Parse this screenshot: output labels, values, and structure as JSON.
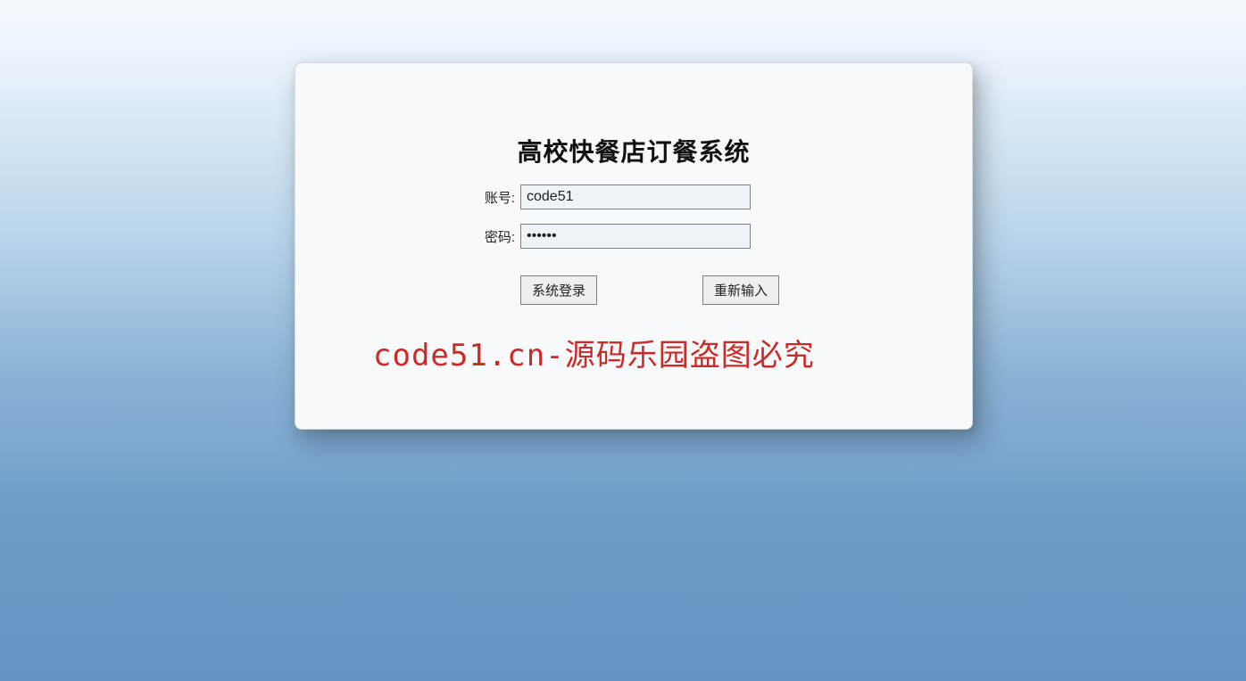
{
  "title": "高校快餐店订餐系统",
  "form": {
    "username_label": "账号:",
    "username_value": "code51",
    "password_label": "密码:",
    "password_value": "••••••"
  },
  "buttons": {
    "login": "系统登录",
    "reset": "重新输入"
  },
  "watermark": "code51.cn-源码乐园盗图必究"
}
